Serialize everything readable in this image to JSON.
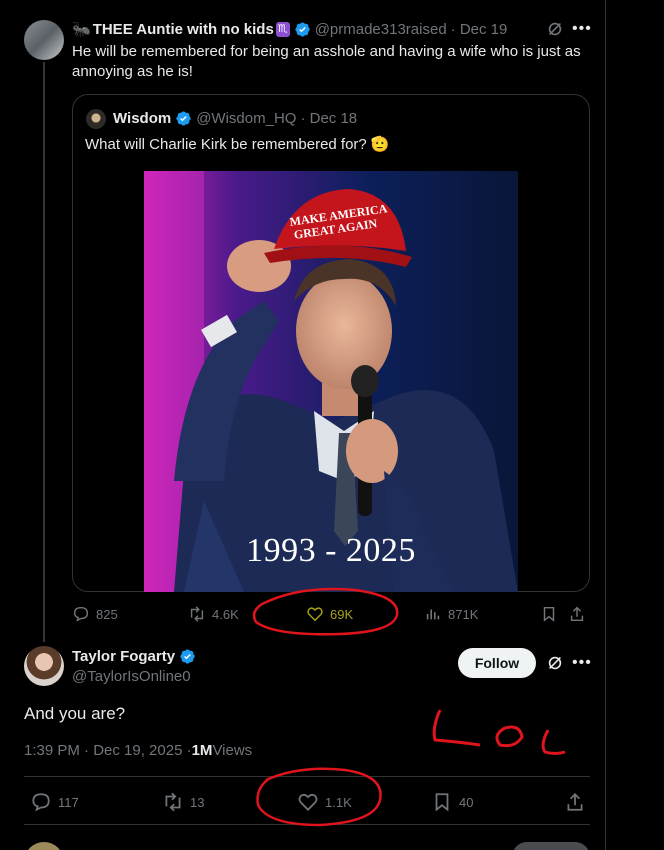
{
  "tweet1": {
    "display_name": "THEE Auntie with no kids",
    "zodiac": "♏",
    "handle": "@prmade313raised",
    "date": "· Dec 19",
    "text": "He will be remembered for being an asshole and having a wife who is just as annoying as he is!",
    "quote": {
      "display_name": "Wisdom",
      "handle": "@Wisdom_HQ",
      "date": "· Dec 18",
      "text": "What will Charlie Kirk be remembered for? 🫡",
      "image_caption": "1993 - 2025",
      "hat_text_line1": "MAKE AMERICA",
      "hat_text_line2": "GREAT AGAIN"
    },
    "stats": {
      "replies": "825",
      "reposts": "4.6K",
      "likes": "69K",
      "views": "871K"
    }
  },
  "tweet2": {
    "display_name": "Taylor Fogarty",
    "handle": "@TaylorIsOnline0",
    "follow_label": "Follow",
    "text": "And you are?",
    "timestamp": "1:39 PM · Dec 19, 2025 · ",
    "views_count": "1M",
    "views_label": " Views",
    "stats": {
      "replies": "117",
      "reposts": "13",
      "likes": "1.1K",
      "bookmarks": "40"
    }
  },
  "annotations": {
    "handwriting": "LOL"
  },
  "colors": {
    "background": "#000000",
    "accent_blue": "#1d9bf0",
    "muted": "#71767b",
    "annotation_red": "#e0141c",
    "liked_yellow": "#a8a31a"
  }
}
